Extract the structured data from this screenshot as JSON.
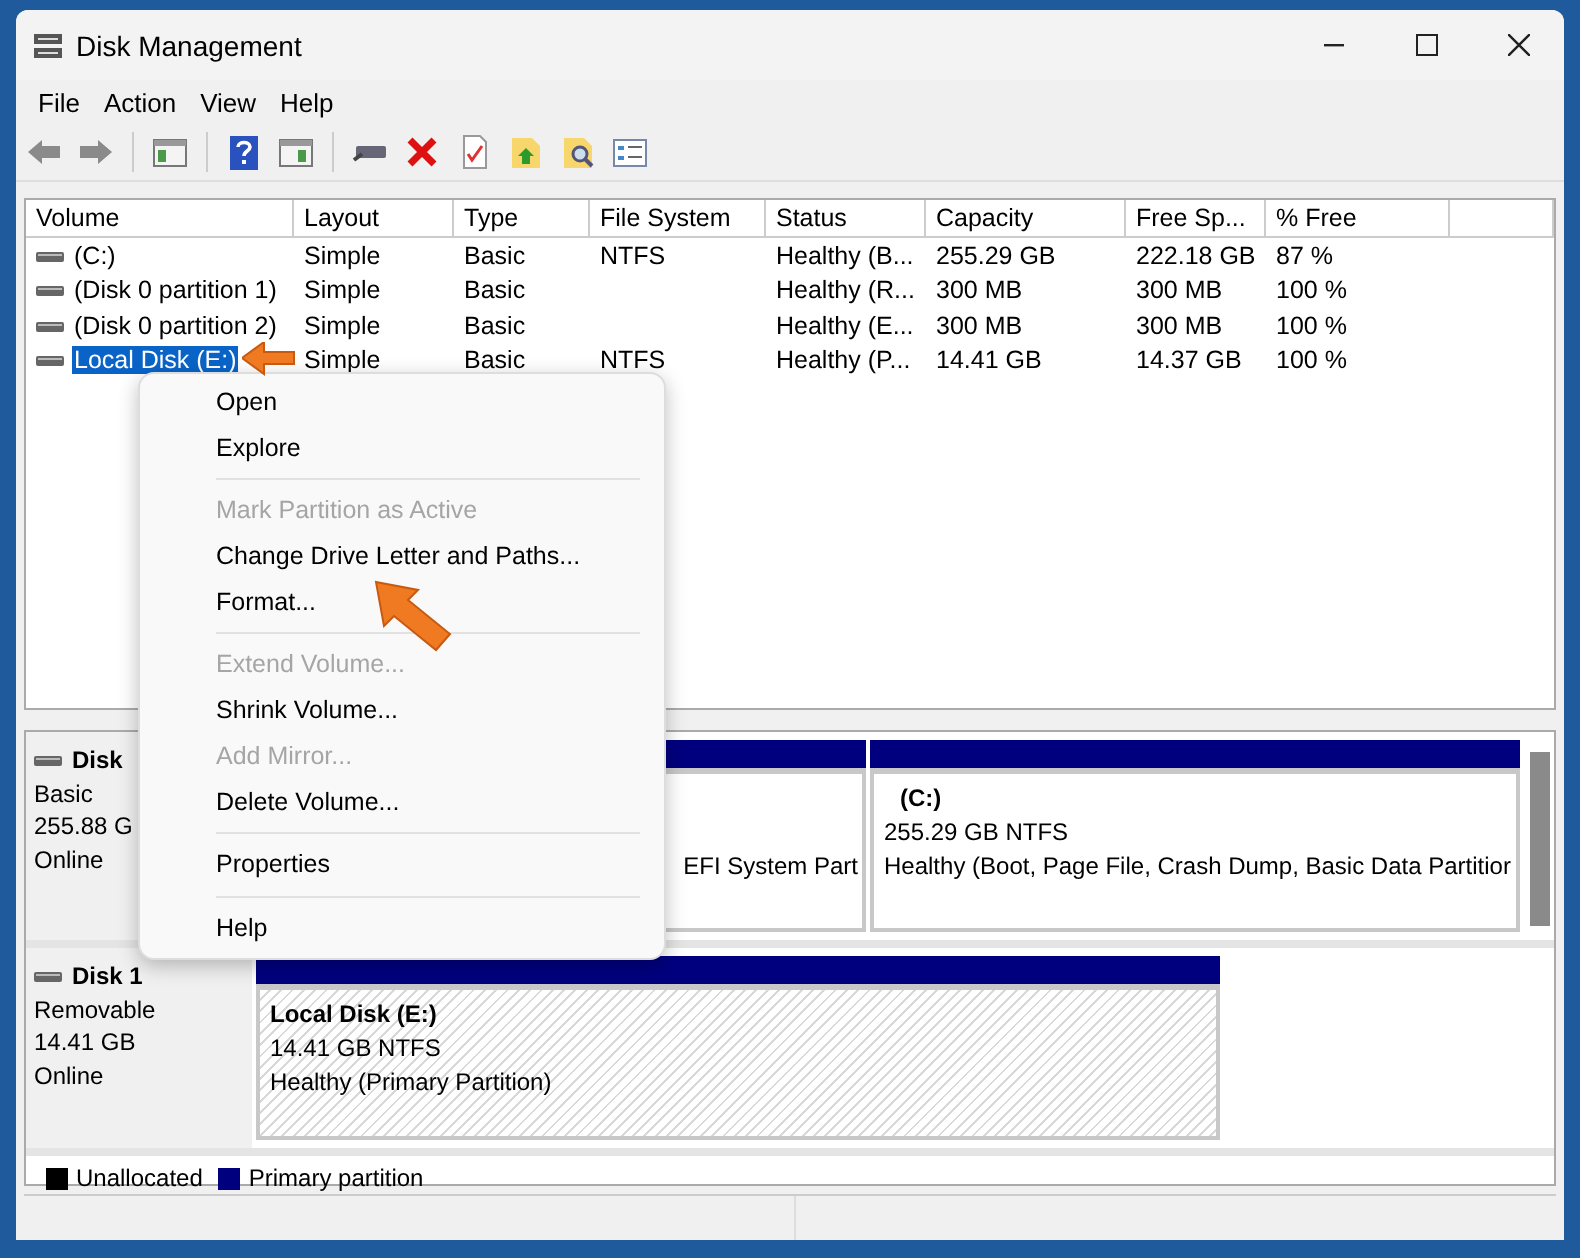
{
  "window": {
    "title": "Disk Management"
  },
  "menu": [
    "File",
    "Action",
    "View",
    "Help"
  ],
  "volumes": {
    "columns": [
      "Volume",
      "Layout",
      "Type",
      "File System",
      "Status",
      "Capacity",
      "Free Sp...",
      "% Free"
    ],
    "rows": [
      {
        "selected": false,
        "cells": [
          "(C:)",
          "Simple",
          "Basic",
          "NTFS",
          "Healthy (B...",
          "255.29 GB",
          "222.18 GB",
          "87 %"
        ]
      },
      {
        "selected": false,
        "cells": [
          "(Disk 0 partition 1)",
          "Simple",
          "Basic",
          "",
          "Healthy (R...",
          "300 MB",
          "300 MB",
          "100 %"
        ]
      },
      {
        "selected": false,
        "cells": [
          "(Disk 0 partition 2)",
          "Simple",
          "Basic",
          "",
          "Healthy (E...",
          "300 MB",
          "300 MB",
          "100 %"
        ]
      },
      {
        "selected": true,
        "cells": [
          "Local Disk (E:)",
          "Simple",
          "Basic",
          "NTFS",
          "Healthy (P...",
          "14.41 GB",
          "14.37 GB",
          "100 %"
        ]
      }
    ]
  },
  "disks": [
    {
      "name": "Disk",
      "lines": [
        "Basic",
        "255.88 G",
        "Online"
      ],
      "partitions": [
        {
          "status": "EFI System Part"
        },
        {
          "selected": false,
          "name": "(C:)",
          "lines": [
            "255.29 GB NTFS",
            "Healthy (Boot, Page File, Crash Dump, Basic Data Partitior"
          ]
        }
      ]
    },
    {
      "name": "Disk 1",
      "lines": [
        "Removable",
        "14.41 GB",
        "Online"
      ],
      "partitions": [
        {
          "selected": true,
          "name": "Local Disk  (E:)",
          "lines": [
            "14.41 GB NTFS",
            "Healthy (Primary Partition)"
          ]
        }
      ]
    }
  ],
  "legend": [
    {
      "label": "Unallocated",
      "color": "#000000"
    },
    {
      "label": "Primary partition",
      "color": "#00007f"
    }
  ],
  "context_menu": [
    {
      "kind": "item",
      "label": "Open",
      "disabled": false
    },
    {
      "kind": "item",
      "label": "Explore",
      "disabled": false
    },
    {
      "kind": "separator"
    },
    {
      "kind": "item",
      "label": "Mark Partition as Active",
      "disabled": true
    },
    {
      "kind": "item",
      "label": "Change Drive Letter and Paths...",
      "disabled": false
    },
    {
      "kind": "item",
      "label": "Format...",
      "disabled": false
    },
    {
      "kind": "separator"
    },
    {
      "kind": "item",
      "label": "Extend Volume...",
      "disabled": true
    },
    {
      "kind": "item",
      "label": "Shrink Volume...",
      "disabled": false
    },
    {
      "kind": "item",
      "label": "Add Mirror...",
      "disabled": true
    },
    {
      "kind": "item",
      "label": "Delete Volume...",
      "disabled": false
    },
    {
      "kind": "separator"
    },
    {
      "kind": "item",
      "label": "Properties",
      "disabled": false
    },
    {
      "kind": "separator"
    },
    {
      "kind": "item",
      "label": "Help",
      "disabled": false
    }
  ]
}
